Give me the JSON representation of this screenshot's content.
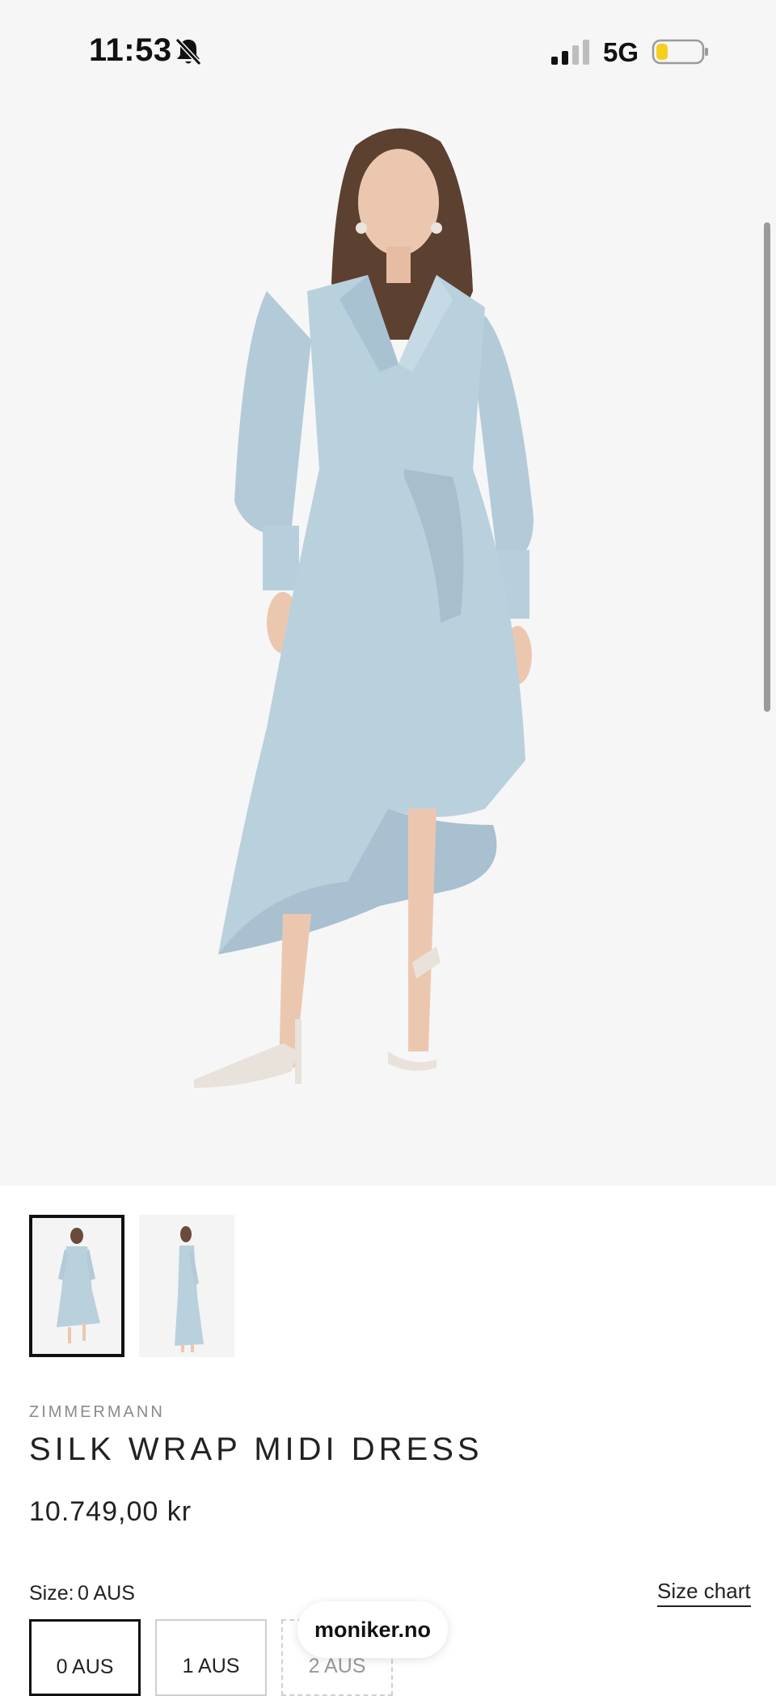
{
  "status_bar": {
    "time": "11:53",
    "network": "5G",
    "icons": [
      "bell-slash-icon",
      "signal-icon",
      "battery-icon"
    ],
    "battery_color": "#f5cf1d"
  },
  "product": {
    "brand": "ZIMMERMANN",
    "name": "SILK WRAP MIDI DRESS",
    "price": "10.749,00 kr",
    "dress_color": "#b9d0dd",
    "image_background": "#f6f6f6"
  },
  "thumbnails": [
    {
      "label": "front view",
      "selected": true
    },
    {
      "label": "side view",
      "selected": false
    }
  ],
  "size": {
    "label": "Size:",
    "selected_value": "0 AUS",
    "chart_link": "Size chart",
    "options": [
      {
        "label": "0 AUS",
        "state": "selected"
      },
      {
        "label": "1 AUS",
        "state": "available"
      },
      {
        "label": "2 AUS",
        "state": "unavailable"
      }
    ]
  },
  "browser": {
    "domain": "moniker.no"
  }
}
